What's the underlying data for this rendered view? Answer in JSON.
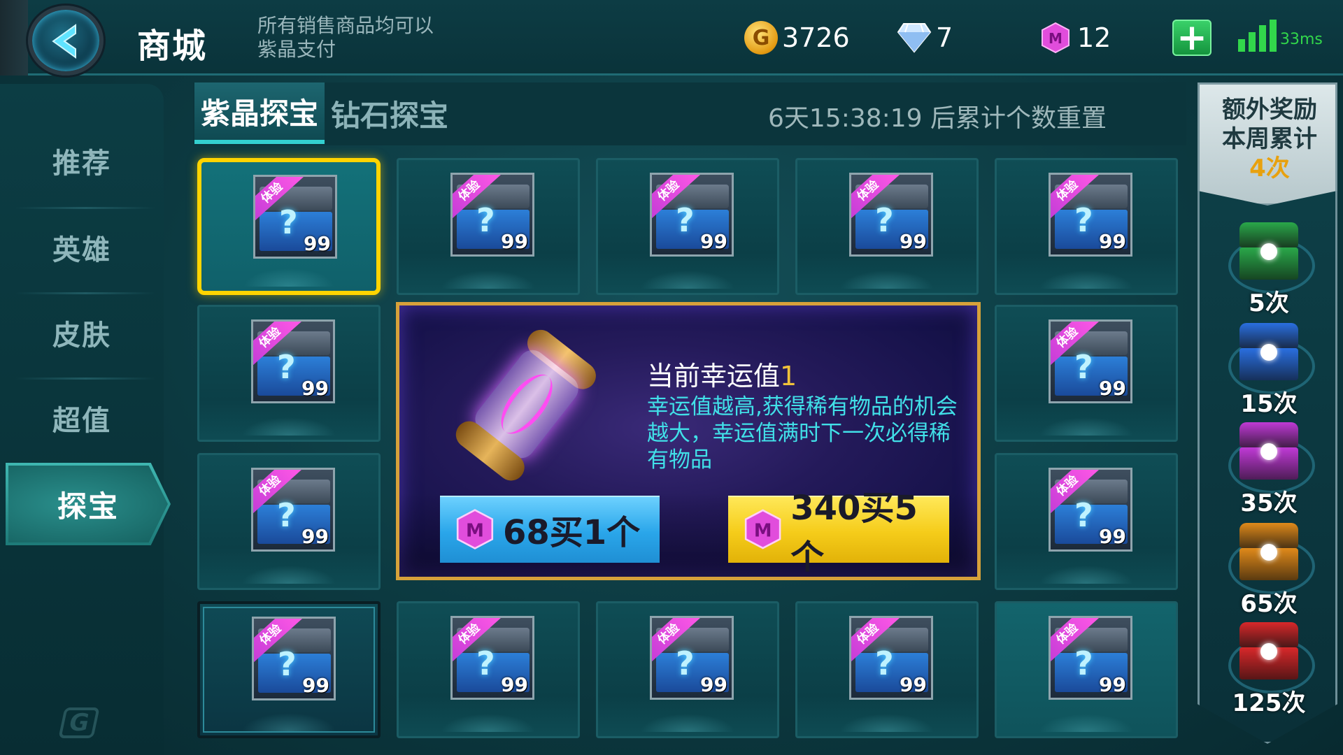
{
  "header": {
    "title": "商城",
    "notice": "所有销售商品均可以紫晶支付",
    "gold": "3726",
    "diamond": "7",
    "amethyst": "12",
    "ping": "33ms"
  },
  "sidebar": {
    "items": [
      {
        "label": "推荐"
      },
      {
        "label": "英雄"
      },
      {
        "label": "皮肤"
      },
      {
        "label": "超值"
      },
      {
        "label": "探宝"
      }
    ],
    "active_index": 4
  },
  "tabs": [
    {
      "label": "紫晶探宝",
      "active": true
    },
    {
      "label": "钻石探宝",
      "active": false
    }
  ],
  "countdown": "6天15:38:19 后累计个数重置",
  "grid_item": {
    "tag": "体验",
    "count": "99"
  },
  "panel": {
    "luck_label": "当前幸运值",
    "luck_value": "1",
    "description": "幸运值越高,获得稀有物品的机会越大，幸运值满时下一次必得稀有物品",
    "buy_one": "68买1个",
    "buy_five": "340买5个"
  },
  "bonus": {
    "line1": "额外奖励",
    "line2": "本周累计",
    "count": "4次",
    "rewards": [
      {
        "label": "5次",
        "color": "#2aa84a"
      },
      {
        "label": "15次",
        "color": "#2a6fe0"
      },
      {
        "label": "35次",
        "color": "#c03ad6"
      },
      {
        "label": "65次",
        "color": "#e08a1a"
      },
      {
        "label": "125次",
        "color": "#d8282a"
      }
    ]
  },
  "colors": {
    "accent_teal": "#33d0d0",
    "selected_border": "#ffd400",
    "amethyst": "#d63ad6",
    "buy_one_bg": "#2aa6ea",
    "buy_five_bg": "#f5cc1a",
    "luck_desc": "#41e0e8"
  }
}
